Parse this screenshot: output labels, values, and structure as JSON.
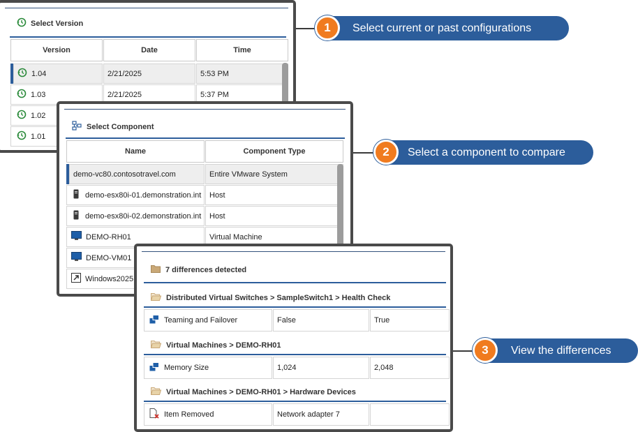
{
  "version_panel": {
    "title": "Select Version",
    "columns": [
      "Version",
      "Date",
      "Time"
    ],
    "rows": [
      {
        "version": "1.04",
        "date": "2/21/2025",
        "time": "5:53 PM",
        "selected": true
      },
      {
        "version": "1.03",
        "date": "2/21/2025",
        "time": "5:37 PM",
        "selected": false
      },
      {
        "version": "1.02",
        "date": "",
        "time": "",
        "selected": false
      },
      {
        "version": "1.01",
        "date": "",
        "time": "",
        "selected": false
      }
    ]
  },
  "component_panel": {
    "title": "Select Component",
    "columns": [
      "Name",
      "Component Type"
    ],
    "rows": [
      {
        "name": "demo-vc80.contosotravel.com",
        "type": "Entire VMware System",
        "icon": "none",
        "selected": true
      },
      {
        "name": "demo-esx80i-01.demonstration.int",
        "type": "Host",
        "icon": "server-icon",
        "selected": false
      },
      {
        "name": "demo-esx80i-02.demonstration.int",
        "type": "Host",
        "icon": "server-icon",
        "selected": false
      },
      {
        "name": "DEMO-RH01",
        "type": "Virtual Machine",
        "icon": "monitor-icon",
        "selected": false
      },
      {
        "name": "DEMO-VM01",
        "type": "",
        "icon": "monitor-icon",
        "selected": false
      },
      {
        "name": "Windows2025",
        "type": "",
        "icon": "shortcut-icon",
        "selected": false
      }
    ]
  },
  "diff_panel": {
    "summary": "7 differences detected",
    "groups": [
      {
        "path": "Distributed Virtual Switches > SampleSwitch1 > Health Check",
        "row": {
          "setting": "Teaming and Failover",
          "old": "False",
          "new": "True",
          "icon": "setting-icon"
        }
      },
      {
        "path": "Virtual Machines > DEMO-RH01",
        "row": {
          "setting": "Memory Size",
          "old": "1,024",
          "new": "2,048",
          "icon": "setting-icon"
        }
      },
      {
        "path": "Virtual Machines > DEMO-RH01 > Hardware Devices",
        "row": {
          "setting": "Item Removed",
          "old": "Network adapter 7",
          "new": "",
          "icon": "removed-icon"
        }
      }
    ]
  },
  "callouts": [
    {
      "number": "1",
      "text": "Select current or past configurations"
    },
    {
      "number": "2",
      "text": "Select a component to compare"
    },
    {
      "number": "3",
      "text": "View the differences"
    }
  ],
  "colors": {
    "accent": "#2c5d9b",
    "badge": "#f07b1f",
    "frame": "#4a4a4a"
  }
}
